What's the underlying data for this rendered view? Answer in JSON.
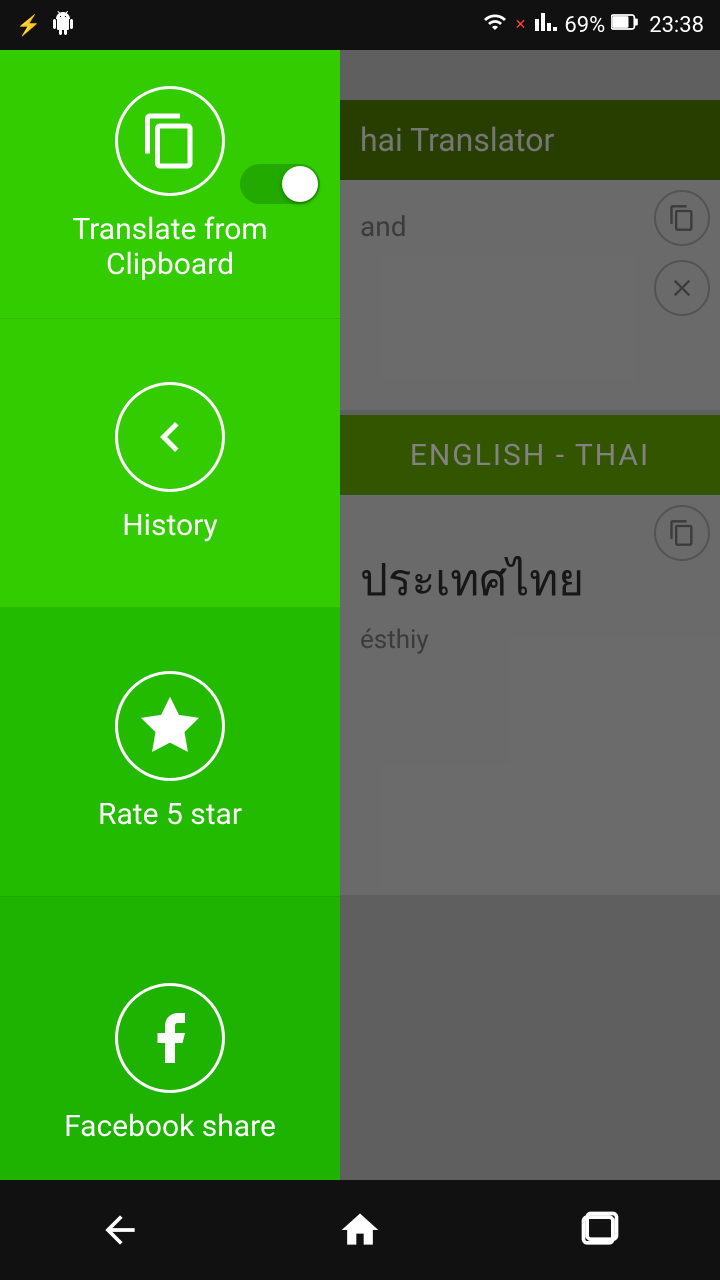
{
  "statusBar": {
    "battery": "69%",
    "time": "23:38",
    "wifiIcon": "wifi",
    "batteryIcon": "battery",
    "androidIcon": "android",
    "usbIcon": "usb"
  },
  "appHeader": {
    "title": "hai Translator"
  },
  "sidebar": {
    "clipboard": {
      "label": "Translate from\nClipboard",
      "toggleEnabled": true
    },
    "history": {
      "label": "History"
    },
    "rateStar": {
      "label": "Rate 5 star"
    },
    "facebook": {
      "label": "Facebook share"
    }
  },
  "translation": {
    "inputText": "and",
    "langButton": "ENGLISH - THAI",
    "outputThai": "ประเทศไทย",
    "outputPhonetic": "ésthiy"
  },
  "bottomNav": {
    "back": "back",
    "home": "home",
    "recents": "recents"
  }
}
